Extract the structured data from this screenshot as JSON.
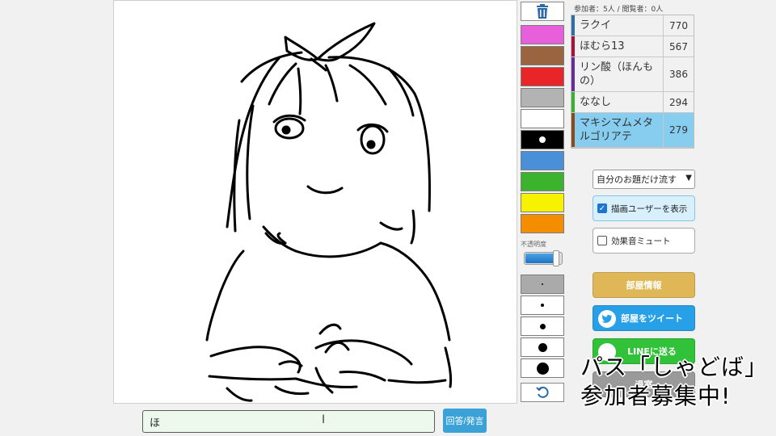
{
  "answer": {
    "input_value": "ほ",
    "submit_label": "回答/発言"
  },
  "tools": {
    "trash_icon": "trash-icon",
    "colors": [
      {
        "name": "magenta",
        "hex": "#e85fdc"
      },
      {
        "name": "brown",
        "hex": "#9b6440"
      },
      {
        "name": "red",
        "hex": "#e8262a"
      },
      {
        "name": "gray",
        "hex": "#b3b3b3"
      },
      {
        "name": "white",
        "hex": "#ffffff"
      },
      {
        "name": "black",
        "hex": "#000000",
        "selected": true
      },
      {
        "name": "blue",
        "hex": "#4a90d9"
      },
      {
        "name": "green",
        "hex": "#3bb32c"
      },
      {
        "name": "yellow",
        "hex": "#f7f200"
      },
      {
        "name": "orange",
        "hex": "#f58d00"
      }
    ],
    "opacity_label": "不透明度",
    "opacity_value": 0.85,
    "sizes": [
      "xs",
      "s",
      "m",
      "l",
      "xl"
    ],
    "selected_size": "xs",
    "undo_icon": "undo-icon"
  },
  "room": {
    "counts_text": "参加者：5人 / 閲覧者：0人"
  },
  "players": [
    {
      "name": "ラクイ",
      "score": "770",
      "color": "#2d6fa8",
      "drawing": false
    },
    {
      "name": "ほむら13",
      "score": "567",
      "color": "#a8123b",
      "drawing": false
    },
    {
      "name": "リン酸（ほんもの）",
      "score": "386",
      "color": "#6a2aa0",
      "drawing": false
    },
    {
      "name": "ななし",
      "score": "294",
      "color": "#38b22f",
      "drawing": false
    },
    {
      "name": "マキシマムメタルゴリアテ",
      "score": "279",
      "color": "#8a4a1a",
      "drawing": true
    }
  ],
  "settings": {
    "filter_select": "自分のお題だけ流す",
    "show_drawer_label": "描画ユーザーを表示",
    "show_drawer_checked": true,
    "mute_label": "効果音ミュート",
    "mute_checked": false
  },
  "buttons": {
    "room_info": "部屋情報",
    "tweet_room": "部屋をツイート",
    "line_send": "LINEに送る",
    "leave": "退室"
  },
  "overlay": {
    "line1": "パス「しゃどば」",
    "line2": "参加者募集中!"
  }
}
